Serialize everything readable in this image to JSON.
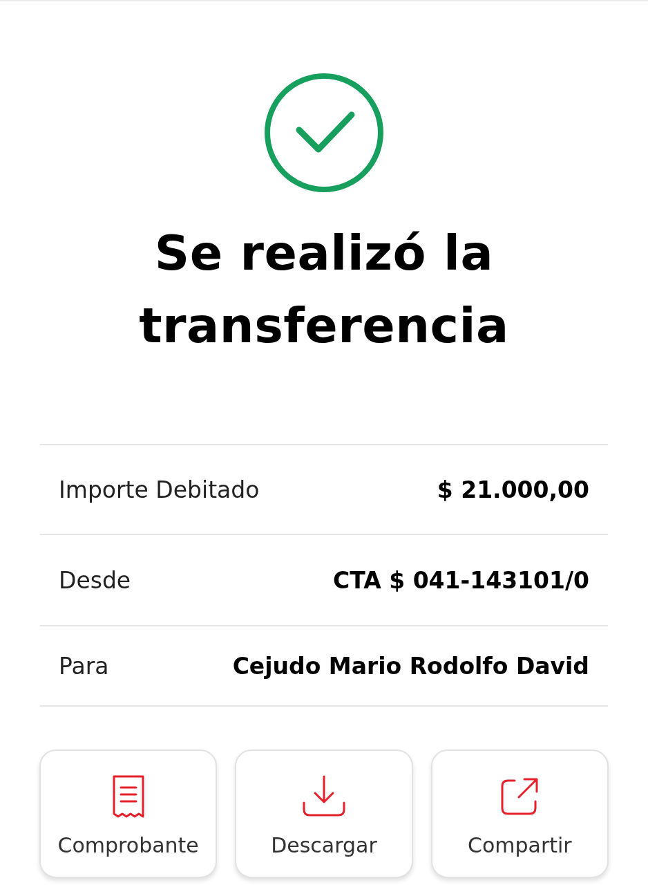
{
  "title": "Se realizó la transferencia",
  "details": [
    {
      "label": "Importe Debitado",
      "value": "$ 21.000,00"
    },
    {
      "label": "Desde",
      "value": "CTA $ 041-143101/0"
    },
    {
      "label": "Para",
      "value": "Cejudo Mario Rodolfo David"
    }
  ],
  "actions": [
    {
      "kind": "receipt",
      "label": "Comprobante"
    },
    {
      "kind": "download",
      "label": "Descargar"
    },
    {
      "kind": "share",
      "label": "Compartir"
    }
  ]
}
